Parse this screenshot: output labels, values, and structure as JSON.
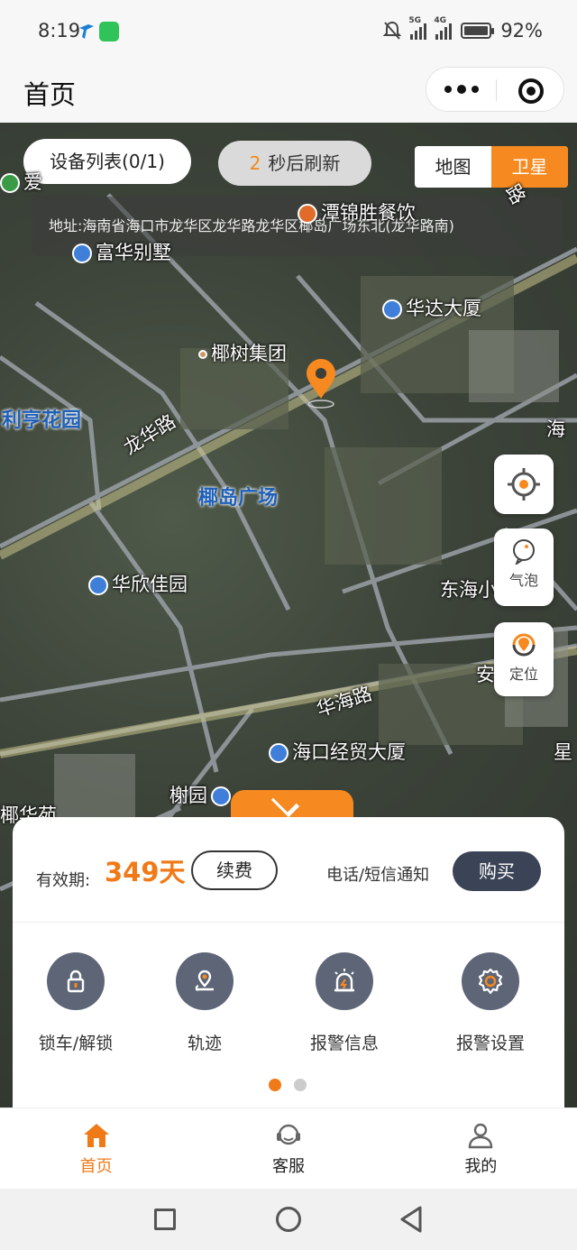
{
  "status_bar": {
    "time": "8:19",
    "battery": "92%",
    "net1": "5G",
    "net2": "4G"
  },
  "header": {
    "title": "首页"
  },
  "map": {
    "device_list_label": "设备列表(0/1)",
    "refresh_count": "2",
    "refresh_label": "秒后刷新",
    "type_map": "地图",
    "type_satellite": "卫星",
    "address": "地址:海南省海口市龙华区龙华路龙华区椰岛广场东北(龙华路南)",
    "labels": {
      "tanjin": "潭锦胜餐饮",
      "fuhua": "富华别墅",
      "huada": "华达大厦",
      "yeshu": "椰树集团",
      "liting": "利亨花园",
      "longhua": "龙华路",
      "yedao": "椰岛广场",
      "huaxin": "华欣佳园",
      "donghai": "东海小",
      "huahai": "华海路",
      "haikou": "海口经贸大厦",
      "shuyuan": "榭园",
      "yehua": "椰华苑",
      "an": "安",
      "xing": "星",
      "hai": "海",
      "lu": "路",
      "ai": "爱"
    },
    "side_bubble": "气泡",
    "side_locate": "定位"
  },
  "panel": {
    "validity_label": "有效期:",
    "validity_days": "349天",
    "renew": "续费",
    "notify": "电话/短信通知",
    "buy": "购买",
    "functions": [
      "锁车/解锁",
      "轨迹",
      "报警信息",
      "报警设置"
    ],
    "page_index": 1,
    "page_count": 2
  },
  "tabbar": {
    "home": "首页",
    "service": "客服",
    "mine": "我的"
  },
  "colors": {
    "accent": "#f6891f",
    "dark_button": "#3b4456",
    "icon_bg": "#5d6577"
  }
}
